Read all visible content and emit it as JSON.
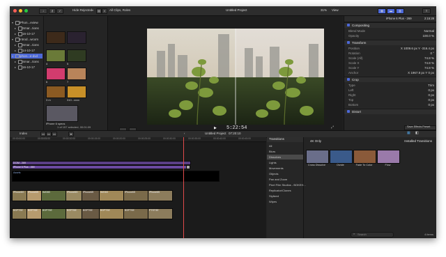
{
  "window": {
    "controls": [
      "close",
      "minimize",
      "zoom"
    ]
  },
  "toolbar": {
    "library_btn": "lib",
    "photos_btn": "img",
    "audio_btn": "aud",
    "browser_filter": "Hide Rejected",
    "viewer_filter": "All Clips, Roles",
    "project_name": "Untitled Project",
    "zoom": "31%",
    "view": "View",
    "inspector_clip": "iPhone 6 Plus - 269",
    "inspector_duration": "2:15:28"
  },
  "libraries": [
    {
      "label": "iPhon...eview",
      "level": 0,
      "open": true,
      "selected": false
    },
    {
      "label": "Smar...tions",
      "level": 1,
      "open": false,
      "selected": false
    },
    {
      "label": "16-10-17",
      "level": 1,
      "open": false,
      "selected": false
    },
    {
      "label": "Introd...wcom",
      "level": 0,
      "open": true,
      "selected": false
    },
    {
      "label": "Smar...tions",
      "level": 1,
      "open": false,
      "selected": false
    },
    {
      "label": "14-10-17",
      "level": 1,
      "open": false,
      "selected": false
    },
    {
      "label": "iphon...e-dvd",
      "level": 0,
      "open": true,
      "selected": true
    },
    {
      "label": "Smar...tions",
      "level": 1,
      "open": false,
      "selected": false
    },
    {
      "label": "16-10-17",
      "level": 1,
      "open": false,
      "selected": false
    }
  ],
  "browser_clips": [
    {
      "label": "",
      "color": "#3d2a1a"
    },
    {
      "label": "",
      "color": "#2a2230"
    },
    {
      "label": "4",
      "color": "#6a7a38"
    },
    {
      "label": "5",
      "color": "#2f3b22"
    },
    {
      "label": "6",
      "color": "#d23c6e"
    },
    {
      "label": "7",
      "color": "#b8845a"
    },
    {
      "label": "3 m",
      "color": "#8b5a22"
    },
    {
      "label": "310...xxxx",
      "color": "#c89028"
    },
    {
      "label": "iPhone 6 specs",
      "color": "#5a5862"
    }
  ],
  "browser_status": "1 of 157 selected, 00:01:09",
  "viewer": {
    "timecode": "5:22:54",
    "controls": [
      "Crop",
      "Transform",
      "Play"
    ]
  },
  "inspector": {
    "compositing_title": "Compositing",
    "compositing": [
      {
        "k": "Blend Mode",
        "v": "Normal"
      },
      {
        "k": "Opacity",
        "v": "100.0 %"
      }
    ],
    "transform_title": "Transform",
    "transform": [
      {
        "k": "Position",
        "v": "X 1009.6 px   Y -316.4 px"
      },
      {
        "k": "Rotation",
        "v": "0 °"
      },
      {
        "k": "Scale (All)",
        "v": "74.8 %"
      },
      {
        "k": "Scale X",
        "v": "74.8 %"
      },
      {
        "k": "Scale Y",
        "v": "74.8 %"
      },
      {
        "k": "Anchor",
        "v": "X 1967.8 px   Y 0 px"
      }
    ],
    "crop_title": "Crop",
    "crop": [
      {
        "k": "Type",
        "v": "Trim"
      },
      {
        "k": "Left",
        "v": "0 px"
      },
      {
        "k": "Right",
        "v": "0 px"
      },
      {
        "k": "Top",
        "v": "0 px"
      },
      {
        "k": "Bottom",
        "v": "0 px"
      }
    ],
    "distort_title": "Distort",
    "save_preset": "Save Effects Preset"
  },
  "timeline_bar": {
    "index": "Index",
    "project": "Untitled Project",
    "duration": "07:20:10"
  },
  "timeline": {
    "ruler": [
      "00:00:00:00",
      "00:00:05:00",
      "00:00:10:00",
      "00:00:15:00",
      "00:00:20:00",
      "00:00:25:00",
      "00:00:30:00",
      "00:00:35:00",
      "00:00:40:00",
      "00:00:45:00"
    ],
    "title_clips": [
      "DCIM - 269",
      "iPhone 6 Plus - 269"
    ],
    "storyline_label": "Assets",
    "clip_labels": [
      "iPhone8G",
      "iPhone6S",
      "IMG8S",
      "iPhone8G",
      "iPhone6S",
      "IMG6G",
      "iPhone6S",
      "iPhone6S"
    ],
    "clip_labels_b": [
      "BSPTSE",
      "BSPTSE",
      "BSPTSE",
      "BSPTSE",
      "BSPTSE",
      "BSPTSE",
      "BSPTSE",
      "PTSTSE"
    ]
  },
  "effects": {
    "title": "Transitions",
    "filter": "4K Only",
    "categories": [
      "All",
      "Blurs",
      "Dissolves",
      "Lights",
      "Movements",
      "Objects",
      "Pan and Zoom",
      "Pixel Film Studios - BOKEH...",
      "Replicator/Clones",
      "Stylized",
      "Wipes"
    ],
    "selected_category": "Dissolves",
    "installed": "Installed Transitions",
    "tiles": [
      {
        "label": "Cross Dissolve",
        "color": "#6a6e8a"
      },
      {
        "label": "Divide",
        "color": "#3a5a8a"
      },
      {
        "label": "Fade To Color",
        "color": "#8a5a3a"
      },
      {
        "label": "Flow",
        "color": "#9a7aaa"
      }
    ],
    "search_placeholder": "Search",
    "count": "4 items"
  }
}
